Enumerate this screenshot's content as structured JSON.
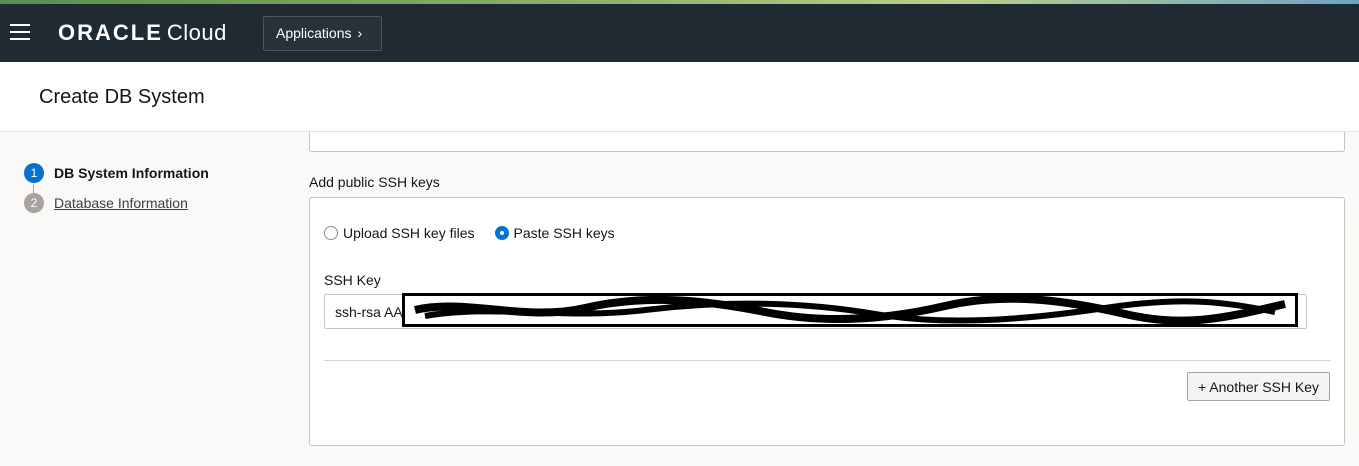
{
  "topbar": {
    "brand_oracle": "ORACLE",
    "brand_cloud": "Cloud",
    "apps_label": "Applications",
    "apps_chevron": "›"
  },
  "header": {
    "title": "Create DB System"
  },
  "steps": [
    {
      "num": "1",
      "label": "DB System Information",
      "state": "current"
    },
    {
      "num": "2",
      "label": "Database Information",
      "state": "pending"
    }
  ],
  "ssh": {
    "section_label": "Add public SSH keys",
    "option_upload": "Upload SSH key files",
    "option_paste": "Paste SSH keys",
    "selected_option": "Paste SSH keys",
    "key_label": "SSH Key",
    "key_value": "ssh-rsa AA",
    "add_button": "+ Another SSH Key"
  },
  "colors": {
    "topbar_bg": "#1f2a33",
    "accent_blue": "#0572ce",
    "page_bg": "#fbf9f8"
  }
}
